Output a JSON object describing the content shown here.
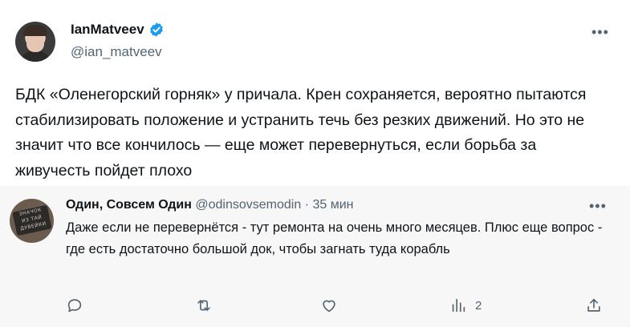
{
  "tweet": {
    "display_name": "IanMatveev",
    "handle": "@ian_matveev",
    "more": "•••",
    "text": "БДК «Оленегорский горняк» у причала. Крен сохраняется, вероятно пытаются стабилизировать положение и устранить течь без резких движений. Но это не значит что все кончилось — еще может перевернуться, если борьба за живучесть пойдет плохо"
  },
  "reply": {
    "display_name": "Один, Совсем Один",
    "handle": "@odinsovsemodin",
    "separator": "·",
    "time": "35 мин",
    "more": "•••",
    "text": "Даже если не перевернётся - тут ремонта на очень много месяцев. Плюс еще вопрос - где есть достаточно большой док, чтобы загнать туда корабль",
    "avatar_text": [
      "ЗНАЧОК",
      "ИЗ ТАЙ",
      "ДУВЕЙКИ"
    ],
    "actions": {
      "reply_icon": "reply-icon",
      "retweet_icon": "retweet-icon",
      "like_icon": "like-icon",
      "views_icon": "views-icon",
      "views_count": "2",
      "share_icon": "share-icon"
    }
  },
  "colors": {
    "text": "#0f1419",
    "secondary": "#536471",
    "verified": "#1d9bf0",
    "reply_bg": "#f7f7f7"
  }
}
